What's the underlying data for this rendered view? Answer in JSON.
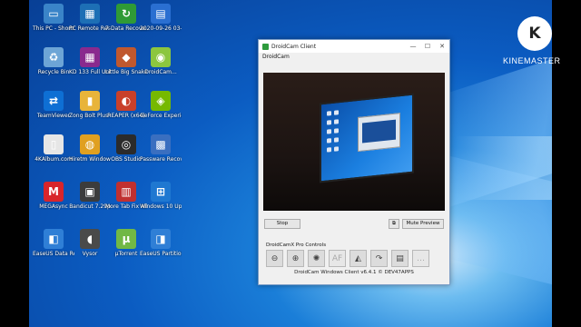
{
  "desktop": {
    "icons": [
      {
        "label": "This PC - Shortcut",
        "color": "#3a84c8",
        "glyph": "▭"
      },
      {
        "label": "PC Remote Receiver",
        "color": "#1d6fb5",
        "glyph": "▦"
      },
      {
        "label": "7-Data Recove...",
        "color": "#2f9a36",
        "glyph": "↻"
      },
      {
        "label": "2020-09-26 03-15-12",
        "color": "#2a6fd1",
        "glyph": "▤"
      },
      {
        "label": "Recycle Bin",
        "color": "#6da5d6",
        "glyph": "♻"
      },
      {
        "label": "KD 133 Full Unlock By...",
        "color": "#8a2a8e",
        "glyph": "▦"
      },
      {
        "label": "Little Big Snake - The...",
        "color": "#c0582e",
        "glyph": "◆"
      },
      {
        "label": "DroidCam...",
        "color": "#8cc63f",
        "glyph": "◉"
      },
      {
        "label": "TeamViewer",
        "color": "#0e6fd4",
        "glyph": "⇄"
      },
      {
        "label": "Zong Bolt Plus Online...",
        "color": "#e8b43a",
        "glyph": "▮"
      },
      {
        "label": "REAPER (x64)",
        "color": "#c9402a",
        "glyph": "◐"
      },
      {
        "label": "GeForce Experience",
        "color": "#76b900",
        "glyph": "◈"
      },
      {
        "label": "4KAlbum.com",
        "color": "#e6e6e6",
        "glyph": "▯"
      },
      {
        "label": "Hiretm Windows8",
        "color": "#e0a020",
        "glyph": "◍"
      },
      {
        "label": "OBS Studio",
        "color": "#2b2b2b",
        "glyph": "◎"
      },
      {
        "label": "Passware Recovery S...",
        "color": "#3a6fc0",
        "glyph": "▩"
      },
      {
        "label": "MEGAsync",
        "color": "#d8252b",
        "glyph": "M"
      },
      {
        "label": "Bandicut 7.29p",
        "color": "#3c3c3c",
        "glyph": "▣"
      },
      {
        "label": "More Tab Fix All Windows",
        "color": "#c03030",
        "glyph": "▥"
      },
      {
        "label": "Windows 10 Update Ass...",
        "color": "#1f78d1",
        "glyph": "⊞"
      },
      {
        "label": "EaseUS Data Recovery W...",
        "color": "#2f7fd6",
        "glyph": "◧"
      },
      {
        "label": "Vysor",
        "color": "#4a4a4a",
        "glyph": "◖"
      },
      {
        "label": "µTorrent",
        "color": "#71b845",
        "glyph": "µ"
      },
      {
        "label": "EaseUS Partition M...",
        "color": "#2f7fd6",
        "glyph": "◨"
      }
    ]
  },
  "window": {
    "title": "DroidCam Client",
    "menu": "DroidCam",
    "stop_label": "Stop",
    "mute_label": "Mute Preview",
    "pro_label": "DroidCamX Pro Controls",
    "footer": "DroidCam Windows Client v6.4.1 © DEV47APPS",
    "pro_buttons": [
      {
        "icon": "zoom-out-icon",
        "glyph": "⊖",
        "enabled": true
      },
      {
        "icon": "zoom-in-icon",
        "glyph": "⊕",
        "enabled": true
      },
      {
        "icon": "brightness-icon",
        "glyph": "✺",
        "enabled": true
      },
      {
        "icon": "autofocus-icon",
        "glyph": "AF",
        "enabled": false
      },
      {
        "icon": "flip-icon",
        "glyph": "◭",
        "enabled": true
      },
      {
        "icon": "rotate-icon",
        "glyph": "↷",
        "enabled": true
      },
      {
        "icon": "save-icon",
        "glyph": "▤",
        "enabled": true
      },
      {
        "icon": "more-icon",
        "glyph": "…",
        "enabled": false
      }
    ]
  },
  "watermark": {
    "logo": "K",
    "text": "KINEMASTER"
  }
}
